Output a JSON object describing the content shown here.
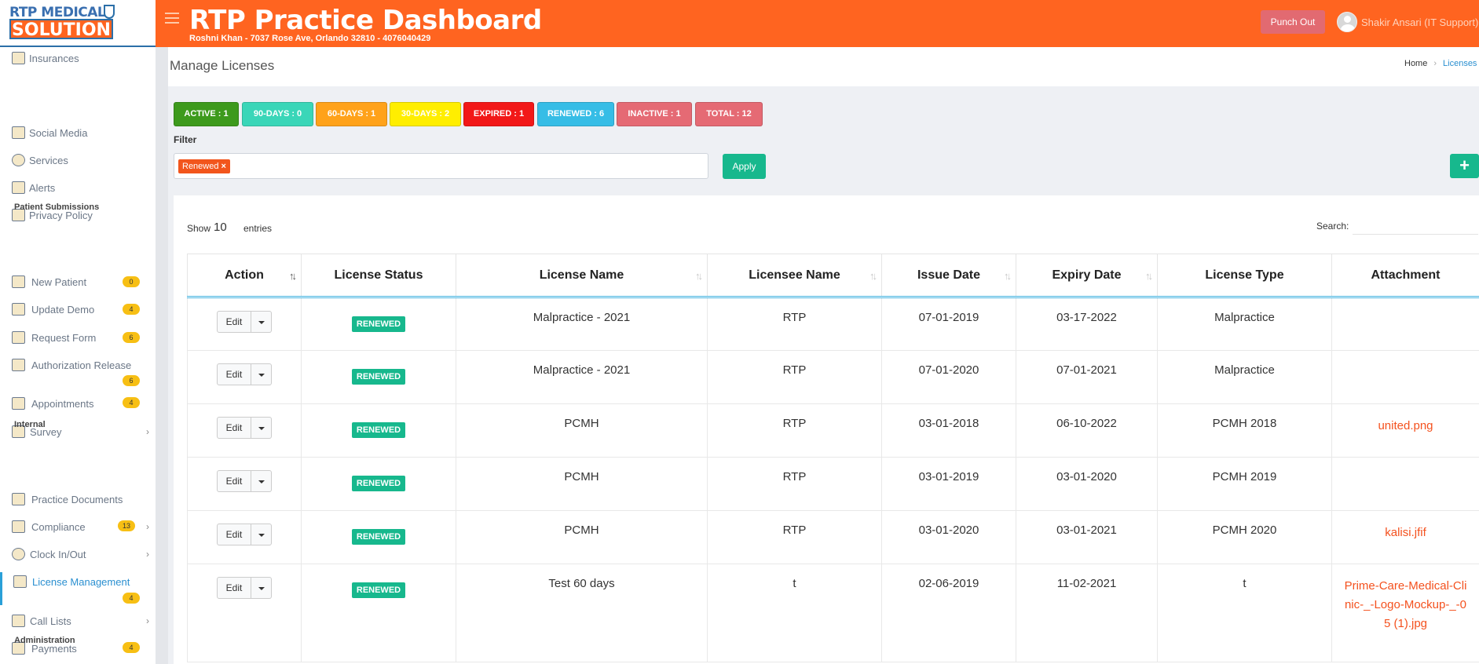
{
  "header": {
    "logo_line1": "RTP MEDICAL",
    "logo_line2": "SOLUTION",
    "title": "RTP Practice Dashboard",
    "subtitle": "Roshni Khan - 7037 Rose Ave, Orlando 32810 - 4076040429",
    "punch_out": "Punch Out",
    "user": "Shakir Ansari (IT Support)"
  },
  "sidebar": {
    "items": [
      {
        "label": "Insurances",
        "icon": "insurance-icon"
      },
      {
        "label": "Social Media",
        "icon": "social-media-icon"
      },
      {
        "label": "Services",
        "icon": "services-icon"
      },
      {
        "label": "Alerts",
        "icon": "alerts-icon"
      },
      {
        "label": "Privacy Policy",
        "icon": "privacy-icon"
      },
      {
        "label": "New Patient",
        "icon": "clipboard-icon",
        "badge": "0"
      },
      {
        "label": "Update Demo",
        "icon": "update-icon",
        "badge": "4"
      },
      {
        "label": "Request Form",
        "icon": "form-icon",
        "badge": "6"
      },
      {
        "label": "Authorization Release",
        "icon": "authorization-icon",
        "badge": "6"
      },
      {
        "label": "Appointments",
        "icon": "calendar-icon",
        "badge": "4"
      },
      {
        "label": "Survey",
        "icon": "survey-icon"
      },
      {
        "label": "Practice Documents",
        "icon": "documents-icon"
      },
      {
        "label": "Compliance",
        "icon": "compliance-icon",
        "badge": "13"
      },
      {
        "label": "Clock In/Out",
        "icon": "clock-icon"
      },
      {
        "label": "License Management",
        "icon": "license-icon",
        "badge": "4"
      },
      {
        "label": "Call Lists",
        "icon": "call-list-icon"
      },
      {
        "label": "Payments",
        "icon": "payments-icon",
        "badge": "4"
      }
    ],
    "sections": [
      "Patient Submissions",
      "Internal",
      "Administration"
    ]
  },
  "page": {
    "title": "Manage Licenses",
    "breadcrumb_home": "Home",
    "breadcrumb_current": "Licenses"
  },
  "filters": {
    "pills": [
      {
        "label": "ACTIVE : 1",
        "color": "#3d9a1c"
      },
      {
        "label": "90-DAYS : 0",
        "color": "#3ad6b8"
      },
      {
        "label": "60-DAYS : 1",
        "color": "#ffa21a"
      },
      {
        "label": "30-DAYS : 2",
        "color": "#ffee00"
      },
      {
        "label": "EXPIRED : 1",
        "color": "#f21818"
      },
      {
        "label": "RENEWED : 6",
        "color": "#36bde6"
      },
      {
        "label": "INACTIVE : 1",
        "color": "#e56a74"
      },
      {
        "label": "TOTAL : 12",
        "color": "#e56a74"
      }
    ],
    "label": "Filter",
    "selected_tag": "Renewed",
    "tag_remove": "×",
    "apply": "Apply",
    "add": "+"
  },
  "table": {
    "show_label": "Show",
    "page_size": "10",
    "entries_label": "entries",
    "search_label": "Search:",
    "search_value": "",
    "edit_label": "Edit",
    "columns": [
      "Action",
      "License Status",
      "License Name",
      "Licensee Name",
      "Issue Date",
      "Expiry Date",
      "License Type",
      "Attachment"
    ],
    "rows": [
      {
        "status": "RENEWED",
        "name": "Malpractice - 2021",
        "licensee": "RTP",
        "issue": "07-01-2019",
        "expiry": "03-17-2022",
        "type": "Malpractice",
        "attachment": ""
      },
      {
        "status": "RENEWED",
        "name": "Malpractice - 2021",
        "licensee": "RTP",
        "issue": "07-01-2020",
        "expiry": "07-01-2021",
        "type": "Malpractice",
        "attachment": ""
      },
      {
        "status": "RENEWED",
        "name": "PCMH",
        "licensee": "RTP",
        "issue": "03-01-2018",
        "expiry": "06-10-2022",
        "type": "PCMH 2018",
        "attachment": "united.png"
      },
      {
        "status": "RENEWED",
        "name": "PCMH",
        "licensee": "RTP",
        "issue": "03-01-2019",
        "expiry": "03-01-2020",
        "type": "PCMH 2019",
        "attachment": ""
      },
      {
        "status": "RENEWED",
        "name": "PCMH",
        "licensee": "RTP",
        "issue": "03-01-2020",
        "expiry": "03-01-2021",
        "type": "PCMH 2020",
        "attachment": "kalisi.jfif"
      },
      {
        "status": "RENEWED",
        "name": "Test 60 days",
        "licensee": "t",
        "issue": "02-06-2019",
        "expiry": "11-02-2021",
        "type": "t",
        "attachment": "Prime-Care-Medical-Clinic-_-Logo-Mockup-_-05 (1).jpg"
      }
    ]
  }
}
